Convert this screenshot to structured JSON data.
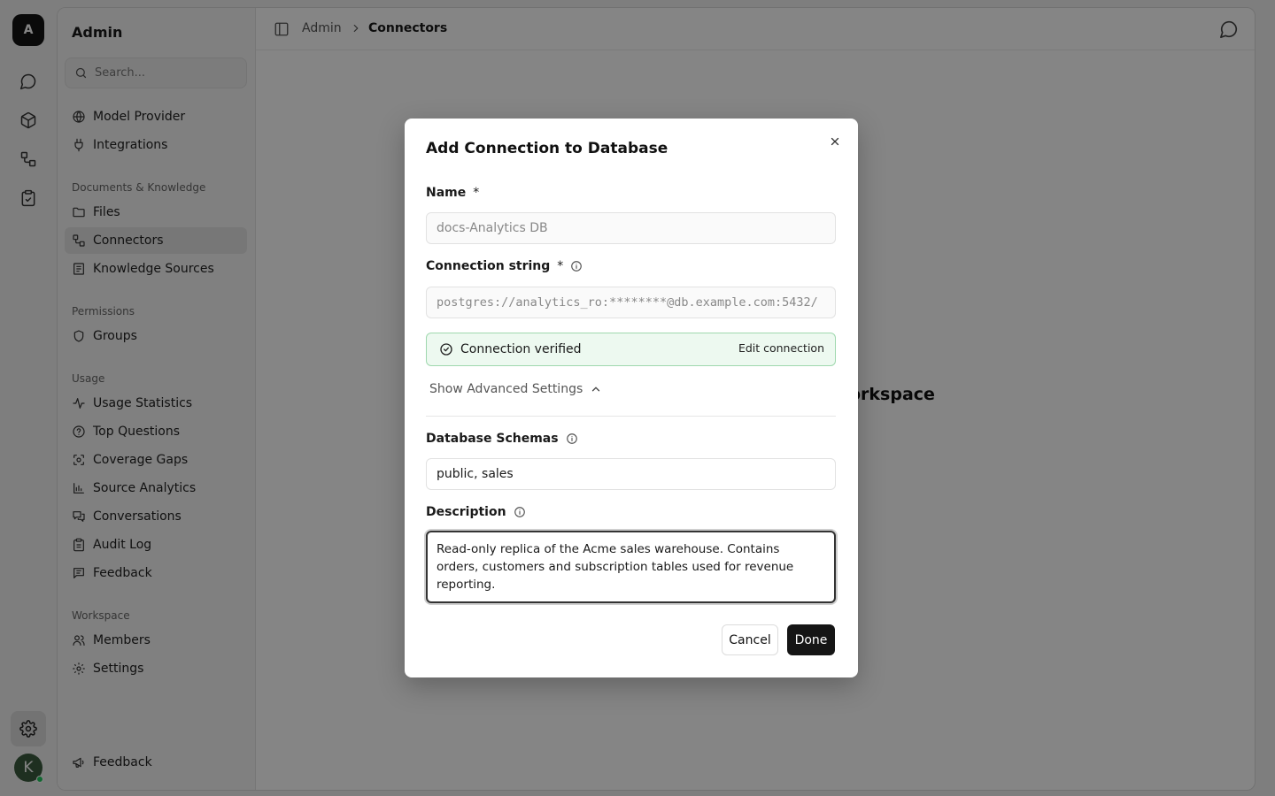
{
  "rail": {
    "workspace_initial": "A",
    "user_initial": "K",
    "icons": [
      "chat-icon",
      "cube-icon",
      "connectors-icon",
      "clipboard-icon",
      "settings-icon"
    ]
  },
  "sidebar": {
    "title": "Admin",
    "search_placeholder": "Search...",
    "items_top": [
      {
        "label": "Model Provider",
        "icon": "globe-icon"
      },
      {
        "label": "Integrations",
        "icon": "plug-icon"
      }
    ],
    "sections": [
      {
        "title": "Documents & Knowledge",
        "items": [
          {
            "label": "Files",
            "icon": "folder-icon"
          },
          {
            "label": "Connectors",
            "icon": "connectors-icon",
            "active": true
          },
          {
            "label": "Knowledge Sources",
            "icon": "book-icon"
          }
        ]
      },
      {
        "title": "Permissions",
        "items": [
          {
            "label": "Groups",
            "icon": "shield-icon"
          }
        ]
      },
      {
        "title": "Usage",
        "items": [
          {
            "label": "Usage Statistics",
            "icon": "activity-icon"
          },
          {
            "label": "Top Questions",
            "icon": "help-circle-icon"
          },
          {
            "label": "Coverage Gaps",
            "icon": "scan-icon"
          },
          {
            "label": "Source Analytics",
            "icon": "bar-chart-icon"
          },
          {
            "label": "Conversations",
            "icon": "messages-icon"
          },
          {
            "label": "Audit Log",
            "icon": "clipboard-list-icon"
          },
          {
            "label": "Feedback",
            "icon": "message-square-text-icon"
          }
        ]
      },
      {
        "title": "Workspace",
        "items": [
          {
            "label": "Members",
            "icon": "users-icon"
          },
          {
            "label": "Settings",
            "icon": "gear-icon"
          }
        ]
      }
    ],
    "footer_item": {
      "label": "Feedback",
      "icon": "megaphone-icon"
    }
  },
  "topbar": {
    "breadcrumb_root": "Admin",
    "breadcrumb_current": "Connectors"
  },
  "background": {
    "partial_heading": "orkspace"
  },
  "modal": {
    "title": "Add Connection to Database",
    "name_label": "Name",
    "required_mark": "*",
    "name_value": "docs-Analytics DB",
    "conn_label": "Connection string",
    "conn_value": "postgres://analytics_ro:********@db.example.com:5432/",
    "verified_text": "Connection verified",
    "edit_connection": "Edit connection",
    "advanced_toggle": "Show Advanced Settings",
    "schemas_label": "Database Schemas",
    "schemas_value": "public, sales",
    "description_label": "Description",
    "description_value": "Read-only replica of the Acme sales warehouse. Contains orders, customers and subscription tables used for revenue reporting.",
    "cancel": "Cancel",
    "done": "Done"
  },
  "colors": {
    "verified_bg": "#edf9f0",
    "verified_border": "#9fd8ae",
    "primary_button": "#151515",
    "online_dot": "#22c55e"
  }
}
